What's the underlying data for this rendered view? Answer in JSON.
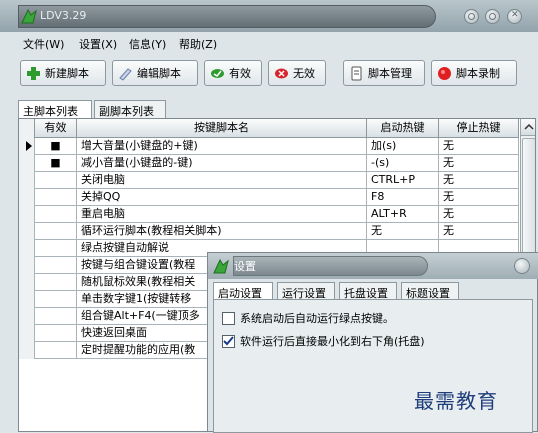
{
  "window": {
    "title": "LDV3.29"
  },
  "menu": [
    "文件(W)",
    "设置(X)",
    "信息(Y)",
    "帮助(Z)"
  ],
  "toolbar": [
    {
      "label": "新建脚本",
      "icon": "new-script-icon"
    },
    {
      "label": "编辑脚本",
      "icon": "edit-script-icon"
    },
    {
      "label": "有效",
      "icon": "enable-icon"
    },
    {
      "label": "无效",
      "icon": "disable-icon"
    },
    {
      "label": "脚本管理",
      "icon": "manage-icon"
    },
    {
      "label": "脚本录制",
      "icon": "record-icon"
    }
  ],
  "tabs": [
    "主脚本列表",
    "副脚本列表"
  ],
  "table": {
    "columns": [
      "有效",
      "按键脚本名",
      "启动热键",
      "停止热键"
    ],
    "rows": [
      {
        "valid": "■",
        "name": "增大音量(小键盘的+键)",
        "start": "加(s)",
        "stop": "无"
      },
      {
        "valid": "■",
        "name": "减小音量(小键盘的-键)",
        "start": "-(s)",
        "stop": "无"
      },
      {
        "valid": "",
        "name": "关闭电脑",
        "start": "CTRL+P",
        "stop": "无"
      },
      {
        "valid": "",
        "name": "关掉QQ",
        "start": "F8",
        "stop": "无"
      },
      {
        "valid": "",
        "name": "重启电脑",
        "start": "ALT+R",
        "stop": "无"
      },
      {
        "valid": "",
        "name": "循环运行脚本(教程相关脚本)",
        "start": "无",
        "stop": "无"
      },
      {
        "valid": "",
        "name": "绿点按键自动解说",
        "start": "",
        "stop": ""
      },
      {
        "valid": "",
        "name": "按键与组合键设置(教程",
        "start": "",
        "stop": ""
      },
      {
        "valid": "",
        "name": "随机鼠标效果(教程相关",
        "start": "",
        "stop": ""
      },
      {
        "valid": "",
        "name": "单击数字键1(按键转移",
        "start": "",
        "stop": ""
      },
      {
        "valid": "",
        "name": "组合键Alt+F4(一键顶多",
        "start": "",
        "stop": ""
      },
      {
        "valid": "",
        "name": "快速返回桌面",
        "start": "",
        "stop": ""
      },
      {
        "valid": "",
        "name": "定时提醒功能的应用(教",
        "start": "",
        "stop": ""
      }
    ]
  },
  "dialog": {
    "title": "设置",
    "tabs": [
      "启动设置",
      "运行设置",
      "托盘设置",
      "标题设置"
    ],
    "options": [
      {
        "label": "系统启动后自动运行绿点按键。",
        "checked": false
      },
      {
        "label": "软件运行后直接最小化到右下角(托盘)",
        "checked": true
      }
    ]
  },
  "watermark": "最需教育",
  "colors": {
    "accent_green": "#2e9b2e",
    "checkmark": "#1a3a8a",
    "title_grey": "#6c777c"
  }
}
